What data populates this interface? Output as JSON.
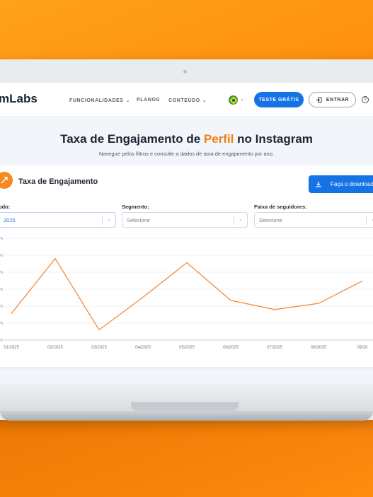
{
  "nav": {
    "logo": "mLabs",
    "items": [
      "FUNCIONALIDADES",
      "PLANOS",
      "CONTEÚDO"
    ],
    "trial_button": "TESTE GRÁTIS",
    "login_button": "ENTRAR"
  },
  "hero": {
    "title_before": "Taxa de Engajamento de ",
    "title_accent": "Perfil",
    "title_after": " no Instagram",
    "subtitle": "Navegue pelos filtros e consulte a dados de taxa de engajamento por ano."
  },
  "card": {
    "title": "Taxa de Engajamento",
    "download_button": "Faça o download",
    "filters": {
      "period_label": "odo:",
      "period_value": "2025",
      "segment_label": "Segmento:",
      "segment_placeholder": "Selecione",
      "followers_label": "Faixa de seguidores:",
      "followers_placeholder": "Selecione"
    }
  },
  "colors": {
    "accent": "#f57c14",
    "primary": "#1673e6",
    "line": "#f58a3c"
  },
  "chart_data": {
    "type": "line",
    "x": [
      "01/2025",
      "02/2025",
      "03/2025",
      "04/2025",
      "05/2025",
      "06/2025",
      "07/2025",
      "08/2025",
      "09/20"
    ],
    "series": [
      {
        "values": [
          0.26,
          0.8,
          0.1,
          0.42,
          0.76,
          0.39,
          0.3,
          0.36,
          0.58
        ]
      }
    ],
    "grid": true
  }
}
